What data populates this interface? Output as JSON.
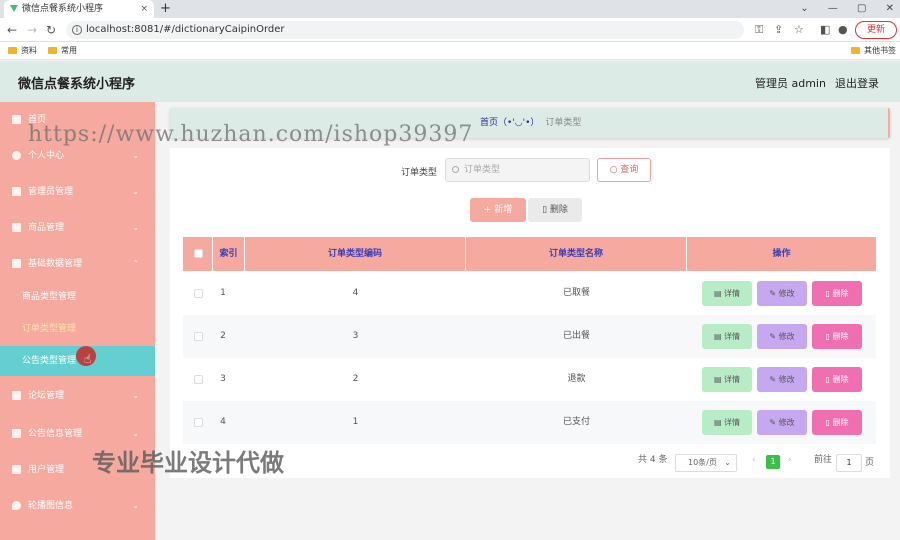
{
  "browser": {
    "tab_title": "微信点餐系统小程序",
    "tab_close": "×",
    "new_tab": "+",
    "window_controls": "⌄ — ▢ ✕",
    "url": "localhost:8081/#/dictionaryCaipinOrder",
    "update_label": "更新",
    "bookmarks": [
      "资料",
      "常用"
    ],
    "other_bookmarks": "其他书签"
  },
  "app": {
    "title": "微信点餐系统小程序",
    "admin_label": "管理员 admin",
    "logout_label": "退出登录"
  },
  "sidebar": {
    "items": [
      {
        "label": "首页"
      },
      {
        "label": "个人中心"
      },
      {
        "label": "管理员管理"
      },
      {
        "label": "商品管理"
      },
      {
        "label": "基础数据管理"
      },
      {
        "label": "论坛管理"
      },
      {
        "label": "公告信息管理"
      },
      {
        "label": "用户管理"
      },
      {
        "label": "轮播图信息"
      }
    ],
    "subitems": [
      {
        "label": "商品类型管理"
      },
      {
        "label": "订单类型管理"
      },
      {
        "label": "公告类型管理"
      }
    ]
  },
  "breadcrumb": {
    "home": "首页（•'◡'•）",
    "current": "订单类型"
  },
  "search": {
    "label": "订单类型",
    "placeholder": "订单类型",
    "button": "查询"
  },
  "actions": {
    "add": "新增",
    "delete": "删除"
  },
  "table": {
    "headers": [
      "索引",
      "订单类型编码",
      "订单类型名称",
      "操作"
    ],
    "rows": [
      {
        "index": "1",
        "code": "4",
        "name": "已取餐"
      },
      {
        "index": "2",
        "code": "3",
        "name": "已出餐"
      },
      {
        "index": "3",
        "code": "2",
        "name": "退款"
      },
      {
        "index": "4",
        "code": "1",
        "name": "已支付"
      }
    ],
    "row_buttons": {
      "detail": "详情",
      "edit": "修改",
      "remove": "删除"
    }
  },
  "pagination": {
    "total": "共 4 条",
    "page_size": "10条/页",
    "current_page": "1",
    "goto_label": "前往",
    "goto_value": "1",
    "page_suffix": "页"
  },
  "watermarks": {
    "url": "https://www.huzhan.com/ishop39397",
    "slogan": "专业毕业设计代做"
  },
  "colors": {
    "sidebar": "#f5a99f",
    "header": "#dcebe6",
    "active_sub": "#63cfd0",
    "detail_btn": "#b8ecc7",
    "edit_btn": "#c5a8ef",
    "delete_btn": "#ef6fb0"
  }
}
